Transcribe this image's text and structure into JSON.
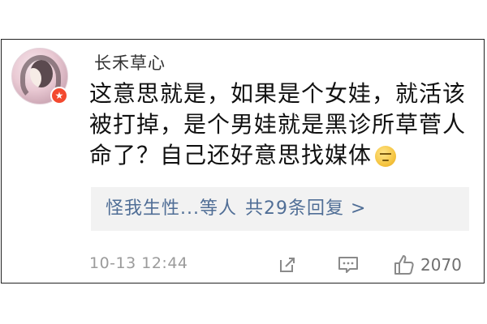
{
  "comment": {
    "username": "长禾草心",
    "avatar_badge_icon": "star-badge-icon",
    "lines": [
      "这意思就是，如果是个女娃，就活该",
      "被打掉，是个男娃就是黑诊所草菅人",
      "命了？自己还好意思找媒体"
    ],
    "emoji_icon": "smirk-emoji-icon"
  },
  "replies": {
    "first_reply": "怪我生性...",
    "suffix": "等人",
    "total": "共29条回复 >"
  },
  "footer": {
    "timestamp": "10-13 12:44",
    "share_icon": "share-icon",
    "comment_icon": "comment-icon",
    "like_icon": "thumbs-up-icon",
    "like_count": "2070"
  },
  "colors": {
    "link": "#506e96",
    "badge": "#f3492f",
    "meta": "#9b9b9b"
  }
}
